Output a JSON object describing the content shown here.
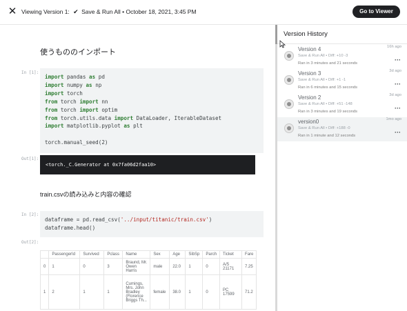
{
  "header": {
    "viewing_label": "Viewing Version 1:",
    "run_mode": "Save & Run All",
    "date": "• October 18, 2021, 3:45 PM",
    "go_to_viewer": "Go to Viewer"
  },
  "notebook": {
    "heading1": "使うもののインポート",
    "cell1_prompt": "In [1]:",
    "cell1_lines": [
      "import pandas as pd",
      "import numpy as np",
      "import torch",
      "from torch import nn",
      "from torch import optim",
      "from torch.utils.data import DataLoader, IterableDataset",
      "import matplotlib.pyplot as plt",
      "",
      "torch.manual_seed(2)"
    ],
    "out1_prompt": "Out[1]:",
    "out1_text": "<torch._C.Generator at 0x7fa06d2faa10>",
    "heading2": "train.csvの読み込みと内容の確認",
    "cell2_prompt": "In [2]:",
    "cell2_lines": [
      "dataframe = pd.read_csv('../input/titanic/train.csv')",
      "dataframe.head()"
    ],
    "out2_prompt": "Out[2]:",
    "table": {
      "headers": [
        "",
        "PassengerId",
        "Survived",
        "Pclass",
        "Name",
        "Sex",
        "Age",
        "SibSp",
        "Parch",
        "Ticket",
        "Fare"
      ],
      "rows": [
        [
          "0",
          "1",
          "0",
          "3",
          "Braund, Mr. Owen Harris",
          "male",
          "22.0",
          "1",
          "0",
          "A/5 21171",
          "7.25"
        ],
        [
          "1",
          "2",
          "1",
          "1",
          "Cumings, Mrs. John Bradley (Florence Briggs Th...",
          "female",
          "38.0",
          "1",
          "0",
          "PC 17599",
          "71.2"
        ]
      ]
    }
  },
  "panel": {
    "title": "Version History",
    "versions": [
      {
        "name": "Version 4",
        "time": "16h ago",
        "diff": "Save & Run All • Diff: +10 -3",
        "ran": "Ran in 3 minutes and 21 seconds"
      },
      {
        "name": "Version 3",
        "time": "3d ago",
        "diff": "Save & Run All • Diff: +1 -1",
        "ran": "Ran in 6 minutes and 15 seconds"
      },
      {
        "name": "Version 2",
        "time": "3d ago",
        "diff": "Save & Run All • Diff: +51 -148",
        "ran": "Ran in 3 minutes and 19 seconds"
      },
      {
        "name": "version0",
        "time": "1mo ago",
        "diff": "Save & Run All • Diff: +188 -0",
        "ran": "Ran in 1 minute and 12 seconds"
      }
    ],
    "menu_glyph": "···"
  },
  "icons": {
    "close": "close-icon",
    "run_mark": "run-all-icon",
    "avatar": "avatar",
    "more": "more-options-icon",
    "cursor": "mouse-cursor-icon"
  },
  "colors": {
    "accent_dark": "#202124",
    "code_bg": "#f1f3f4",
    "keyword": "#2e7d32",
    "string": "#b3261e",
    "output_bg": "#1e1f22"
  }
}
